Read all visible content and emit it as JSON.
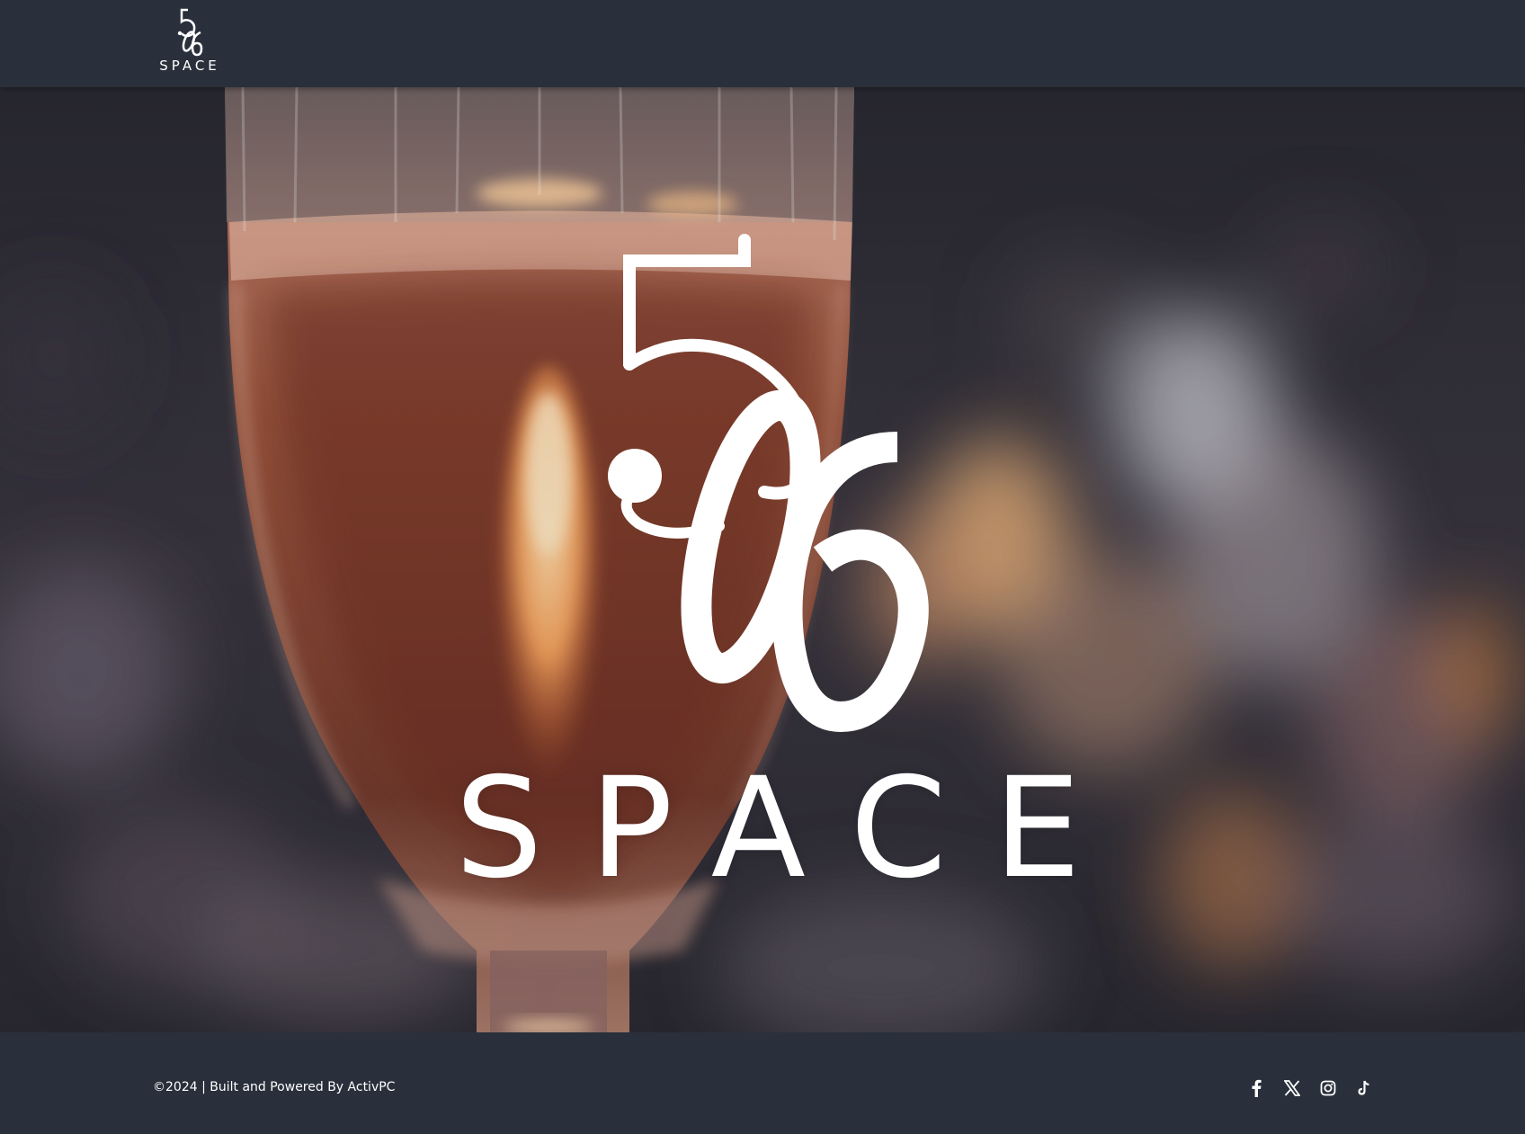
{
  "header": {
    "logo_number": "506",
    "logo_word": "SPACE"
  },
  "hero": {
    "logo_number": "506",
    "logo_word": "SPACE"
  },
  "footer": {
    "copyright": "©2024 | Built and Powered By ActivPC",
    "social": [
      {
        "name": "facebook-icon"
      },
      {
        "name": "x-icon"
      },
      {
        "name": "instagram-icon"
      },
      {
        "name": "tiktok-icon"
      }
    ]
  },
  "colors": {
    "chrome_bg": "#29303b",
    "text": "#ffffff"
  }
}
